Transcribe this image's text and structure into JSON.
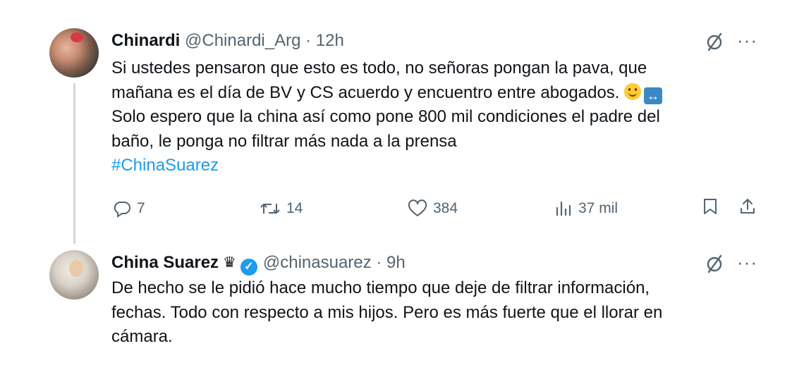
{
  "tweets": [
    {
      "name": "Chinardi",
      "handle": "@Chinardi_Arg",
      "separator": "·",
      "time": "12h",
      "lines": [
        "Si ustedes pensaron que esto es todo, no señoras pongan la pava, que",
        "mañana es el día de BV y CS acuerdo y encuentro entre abogados.",
        "Solo espero que la china así como pone 800 mil condiciones el padre del",
        "baño, le ponga no filtrar más nada a la prensa"
      ],
      "emojis": [
        "slightly-smiling-face",
        "left-right-arrow"
      ],
      "hashtag": "#ChinaSuarez",
      "replies": "7",
      "reposts": "14",
      "likes": "384",
      "views": "37 mil"
    },
    {
      "name": "China Suarez",
      "crown": "♛",
      "verified": "✓",
      "handle": "@chinasuarez",
      "separator": "·",
      "time": "9h",
      "lines": [
        "De hecho se le pidió hace mucho tiempo que deje de filtrar información,",
        "fechas. Todo con respecto a mis hijos. Pero es más fuerte que el llorar en",
        "cámara."
      ]
    }
  ],
  "icons": {
    "more": "···",
    "grok": "grok-icon",
    "reply": "reply-icon",
    "repost": "repost-icon",
    "like": "heart-icon",
    "views": "views-icon",
    "bookmark": "bookmark-icon",
    "share": "share-icon"
  },
  "colors": {
    "text": "#0f1419",
    "secondary": "#536471",
    "link": "#1d9bf0",
    "verified": "#1d9bf0",
    "thread_line": "#cfd9de"
  }
}
